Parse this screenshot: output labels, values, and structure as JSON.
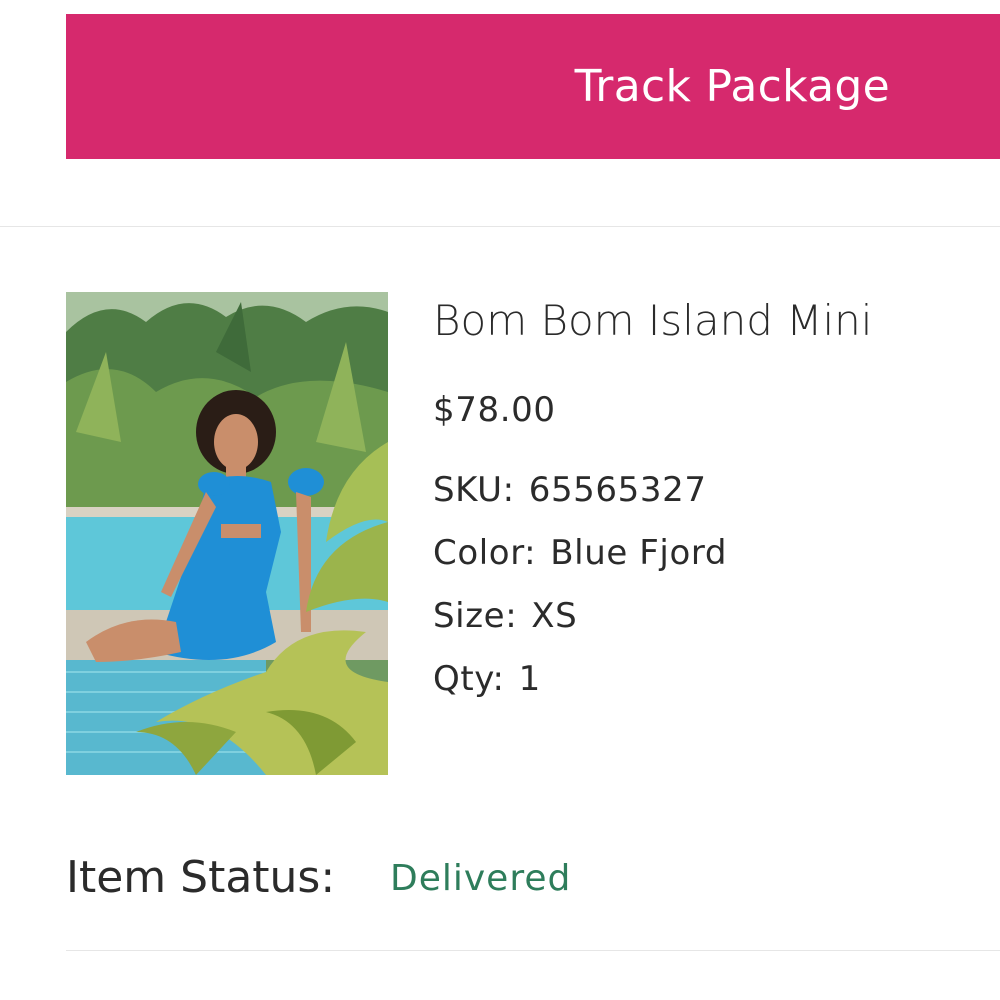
{
  "header": {
    "track_button_label": "Track Package"
  },
  "item": {
    "name": "Bom Bom Island Mini",
    "price": "$78.00",
    "sku_label": "SKU:",
    "sku": "65565327",
    "color_label": "Color:",
    "color": "Blue Fjord",
    "size_label": "Size:",
    "size": "XS",
    "qty_label": "Qty:",
    "qty": "1",
    "image_alt": "Bom Bom Island Mini"
  },
  "status": {
    "label": "Item Status:",
    "value": "Delivered",
    "value_color": "#2e7d5b"
  },
  "theme": {
    "accent": "#d6296d"
  }
}
